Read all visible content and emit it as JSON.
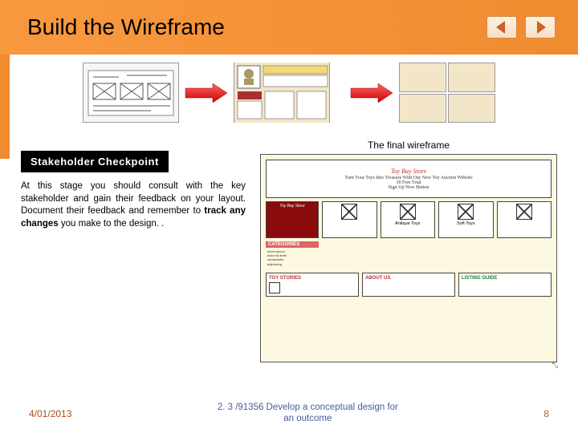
{
  "header": {
    "title": "Build the Wireframe"
  },
  "checkpoint": {
    "label": "Stakeholder Checkpoint",
    "para_before": "At this stage you should consult with the key stakeholder and gain their feedback on your layout. Document their feedback and remember to ",
    "para_bold": "track any changes",
    "para_after": " you make to the design. ."
  },
  "final_caption": "The final wireframe",
  "wireframe": {
    "site_title": "Toy Bay Store",
    "site_tag": "Turn Your Toys Into Treasure With Our New Toy Auction Website",
    "cta1": "30 Free Trial",
    "cta2": "Sign Up Now Button",
    "cats_label": "CATEGORIES",
    "cat1": "Antique Toys",
    "cat2": "Soft Toys",
    "stories": "TOY STORIES",
    "about": "ABOUT US",
    "listing": "LISTING GUIDE"
  },
  "footer": {
    "date": "4/01/2013",
    "mid1": "2. 3 /91356 Develop a conceptual design for",
    "mid2": "an outcome",
    "page": "8"
  },
  "colors": {
    "accent": "#f08b2f"
  }
}
